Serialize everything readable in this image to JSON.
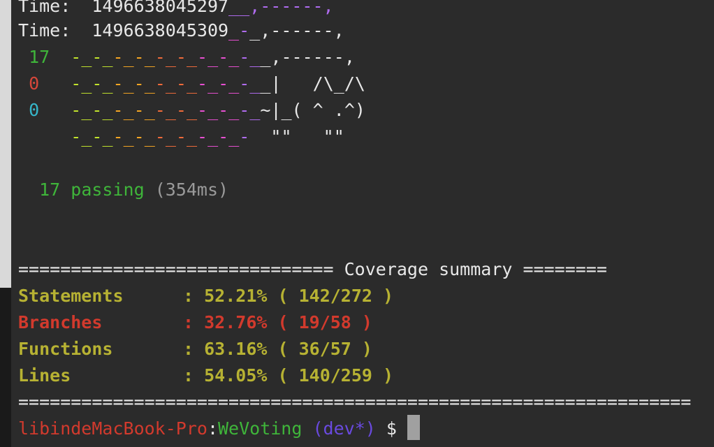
{
  "window": {
    "title": ""
  },
  "log": {
    "line1": {
      "label": "Time:",
      "value": "1496638045297",
      "tail": "__,------,"
    },
    "line2": {
      "label": "Time:",
      "value": "1496638045309",
      "tail_a": "_",
      "tail_b": "-",
      "tail_c": "_,------,"
    }
  },
  "nyan": {
    "rows": [
      {
        "count": "17",
        "trail": "-_-_-_-_-_-_-_-_-_",
        "suffix": "_,------,"
      },
      {
        "count": "0",
        "trail": "-_-_-_-_-_-_-_-_-_",
        "suffix": "_|   /\\_/\\"
      },
      {
        "count": "0",
        "trail": "-_-_-_-_-_-_-_-_-_",
        "suffix": "~|_( ^ .^)"
      },
      {
        "count": "",
        "trail": "-_-_-_-_-_-_-_-_-",
        "suffix": "  \"\"   \"\""
      }
    ]
  },
  "result": {
    "count": "17",
    "word": "passing",
    "duration": "(354ms)"
  },
  "coverage": {
    "header_left": "==============================",
    "header_title": "Coverage summary",
    "header_right": "========",
    "rows": [
      {
        "name": "Statements",
        "sep": ": ",
        "pct": "52.21%",
        "detail": "( 142/272 )",
        "status": "ok"
      },
      {
        "name": "Branches",
        "sep": ": ",
        "pct": "32.76%",
        "detail": "( 19/58 )",
        "status": "low"
      },
      {
        "name": "Functions",
        "sep": ": ",
        "pct": "63.16%",
        "detail": "( 36/57 )",
        "status": "ok"
      },
      {
        "name": "Lines",
        "sep": ": ",
        "pct": "54.05%",
        "detail": "( 140/259 )",
        "status": "ok"
      }
    ],
    "footer": "================================================================"
  },
  "prompt": {
    "host": "libindeMacBook-Pro",
    "colon": ":",
    "dir": "WeVoting",
    "branch": "(dev*)",
    "symbol": "$"
  },
  "colors": {
    "background": "#2b2b2b",
    "green": "#3fb53a",
    "red": "#d6473a",
    "cyan": "#36b6c9",
    "yellow": "#b7b233",
    "purple": "#6a4ae0"
  }
}
